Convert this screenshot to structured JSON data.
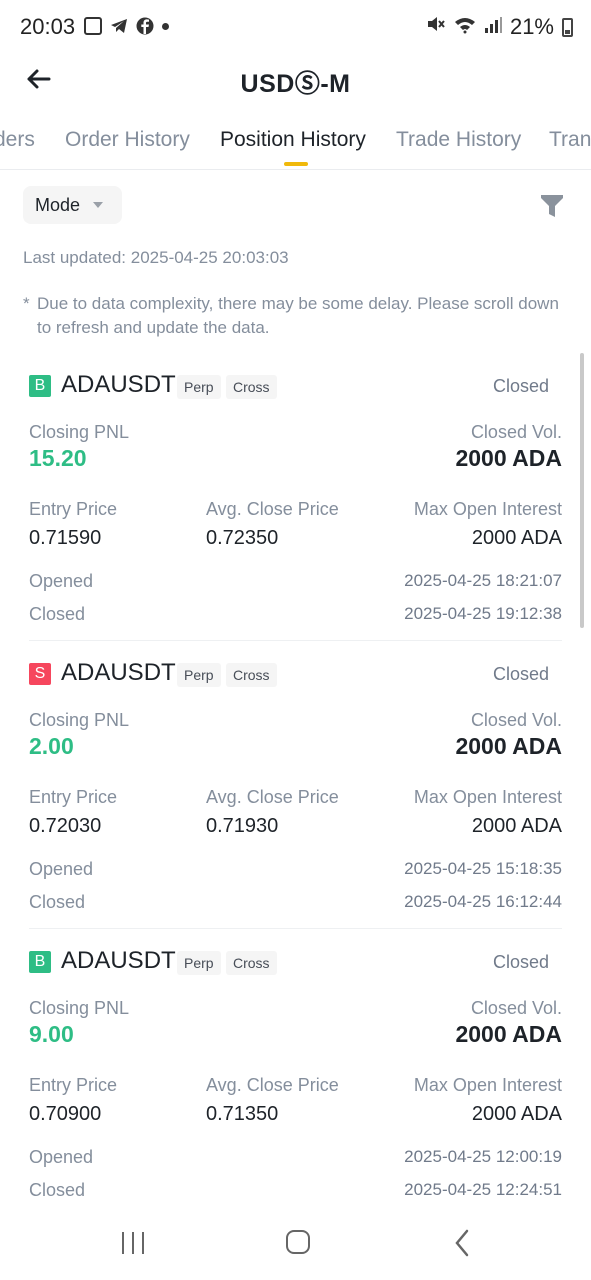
{
  "status_bar": {
    "time": "20:03",
    "battery": "21%"
  },
  "header": {
    "title": "USDⓈ-M"
  },
  "tabs": [
    {
      "label": "ders"
    },
    {
      "label": "Order History"
    },
    {
      "label": "Position History"
    },
    {
      "label": "Trade History"
    },
    {
      "label": "Tran"
    }
  ],
  "active_tab": "Position History",
  "toolbar": {
    "mode_label": "Mode"
  },
  "last_updated": "Last updated: 2025-04-25 20:03:03",
  "note": {
    "star": "*",
    "text": "Due to data complexity, there may be some delay. Please scroll down to refresh and update the data."
  },
  "labels": {
    "closing_pnl": "Closing PNL",
    "closed_vol": "Closed Vol.",
    "entry_price": "Entry Price",
    "avg_close_price": "Avg. Close Price",
    "max_open_interest": "Max Open Interest",
    "opened": "Opened",
    "closed": "Closed"
  },
  "colors": {
    "profit": "#2ebd85",
    "buy": "#2ebd85",
    "sell": "#f6465d",
    "accent": "#f0b90b"
  },
  "positions": [
    {
      "side": "B",
      "symbol": "ADAUSDT",
      "tags": [
        "Perp",
        "Cross"
      ],
      "status": "Closed",
      "closing_pnl": "15.20",
      "closed_vol": "2000 ADA",
      "entry_price": "0.71590",
      "avg_close_price": "0.72350",
      "max_open_interest": "2000 ADA",
      "opened": "2025-04-25 18:21:07",
      "closed": "2025-04-25 19:12:38"
    },
    {
      "side": "S",
      "symbol": "ADAUSDT",
      "tags": [
        "Perp",
        "Cross"
      ],
      "status": "Closed",
      "closing_pnl": "2.00",
      "closed_vol": "2000 ADA",
      "entry_price": "0.72030",
      "avg_close_price": "0.71930",
      "max_open_interest": "2000 ADA",
      "opened": "2025-04-25 15:18:35",
      "closed": "2025-04-25 16:12:44"
    },
    {
      "side": "B",
      "symbol": "ADAUSDT",
      "tags": [
        "Perp",
        "Cross"
      ],
      "status": "Closed",
      "closing_pnl": "9.00",
      "closed_vol": "2000 ADA",
      "entry_price": "0.70900",
      "avg_close_price": "0.71350",
      "max_open_interest": "2000 ADA",
      "opened": "2025-04-25 12:00:19",
      "closed": "2025-04-25 12:24:51"
    }
  ]
}
